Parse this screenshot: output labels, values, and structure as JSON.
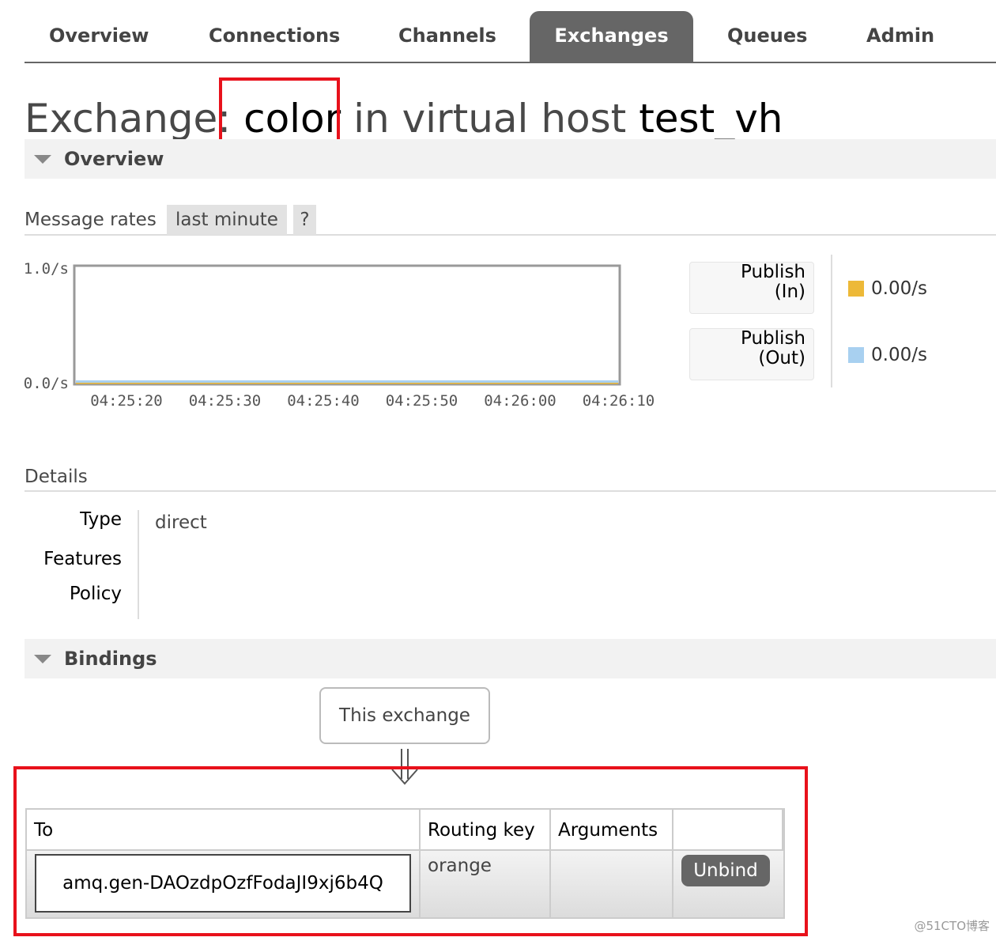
{
  "nav": {
    "tabs": [
      {
        "label": "Overview",
        "active": false
      },
      {
        "label": "Connections",
        "active": false
      },
      {
        "label": "Channels",
        "active": false
      },
      {
        "label": "Exchanges",
        "active": true
      },
      {
        "label": "Queues",
        "active": false
      },
      {
        "label": "Admin",
        "active": false
      }
    ]
  },
  "title": {
    "prefix": "Exchange:",
    "exchange_name": "color",
    "middle": "in virtual host",
    "vhost": "test_vh"
  },
  "overview_section": {
    "label": "Overview"
  },
  "message_rates": {
    "label": "Message rates",
    "range": "last minute",
    "help": "?"
  },
  "chart_data": {
    "type": "line",
    "title": "",
    "y_ticks": [
      "1.0/s",
      "0.0/s"
    ],
    "ylim": [
      0,
      1
    ],
    "x_ticks": [
      "04:25:20",
      "04:25:30",
      "04:25:40",
      "04:25:50",
      "04:26:00",
      "04:26:10"
    ],
    "series": [
      {
        "name": "Publish (In)",
        "color": "#edb938",
        "values": [
          0,
          0,
          0,
          0,
          0,
          0
        ]
      },
      {
        "name": "Publish (Out)",
        "color": "#a8d0f0",
        "values": [
          0,
          0,
          0,
          0,
          0,
          0
        ]
      }
    ]
  },
  "legend": [
    {
      "line1": "Publish",
      "line2": "(In)",
      "value": "0.00/s",
      "color": "#edb938"
    },
    {
      "line1": "Publish",
      "line2": "(Out)",
      "value": "0.00/s",
      "color": "#a8d0f0"
    }
  ],
  "details": {
    "label": "Details",
    "rows": [
      {
        "label": "Type",
        "value": "direct"
      },
      {
        "label": "Features",
        "value": ""
      },
      {
        "label": "Policy",
        "value": ""
      }
    ]
  },
  "bindings_section": {
    "label": "Bindings"
  },
  "bindings": {
    "source_box": "This exchange",
    "headers": [
      "To",
      "Routing key",
      "Arguments",
      ""
    ],
    "rows": [
      {
        "to": "amq.gen-DAOzdpOzfFodaJI9xj6b4Q",
        "routing_key": "orange",
        "arguments": "",
        "action": "Unbind"
      }
    ]
  },
  "watermark": "@51CTO博客",
  "colors": {
    "highlight": "#e8111b",
    "tab_active": "#666666"
  }
}
